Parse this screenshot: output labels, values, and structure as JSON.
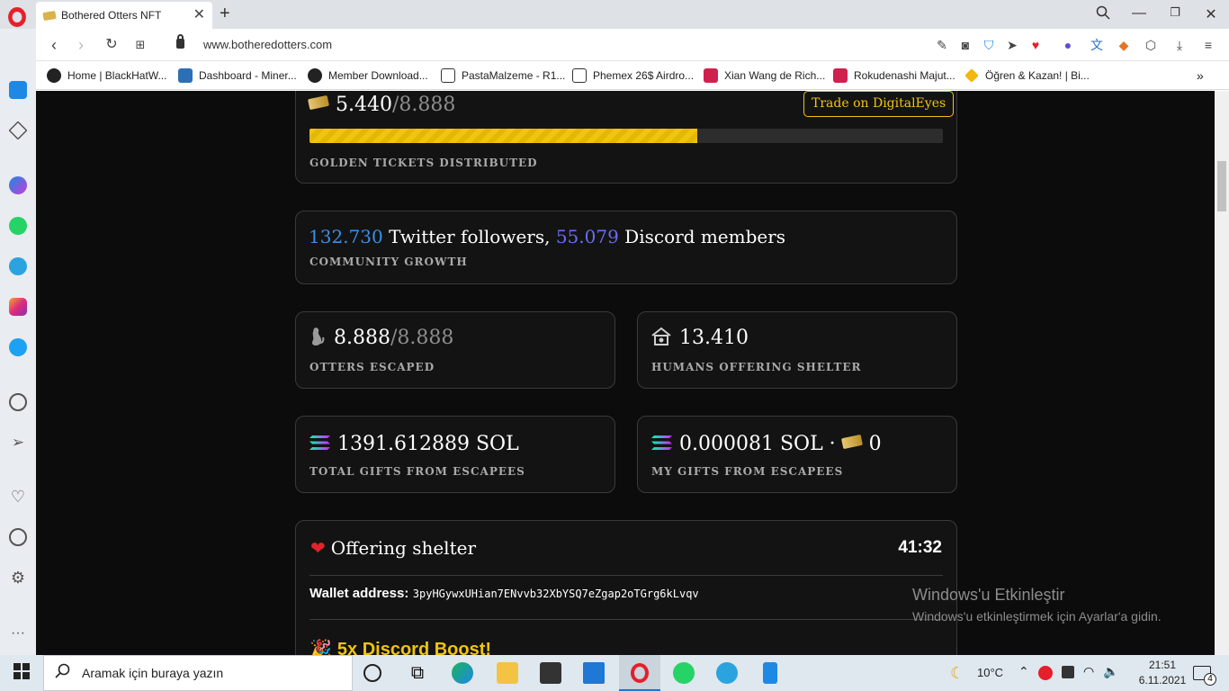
{
  "browser": {
    "tab_title": "Bothered Otters NFT",
    "url": "www.botheredotters.com",
    "bookmarks": [
      "Home | BlackHatW...",
      "Dashboard - Miner...",
      "Member Download...",
      "PastaMalzeme - R1...",
      "Phemex 26$ Airdro...",
      "Xian Wang de Rich...",
      "Rokudenashi Majut...",
      "Öğren & Kazan! | Bi..."
    ],
    "bookmarks_more": "»"
  },
  "tickets": {
    "current": "5.440",
    "total": "/8.888",
    "progress": 0.612,
    "label": "GOLDEN TICKETS DISTRIBUTED",
    "trade_button": "Trade on DigitalEyes"
  },
  "community": {
    "twitter_count": "132.730",
    "twitter_text": " Twitter followers, ",
    "discord_count": "55.079",
    "discord_text": " Discord members",
    "label": "COMMUNITY GROWTH"
  },
  "otters": {
    "current": "8.888",
    "total": "/8.888",
    "label": "OTTERS ESCAPED"
  },
  "humans": {
    "value": "13.410",
    "label": "HUMANS OFFERING SHELTER"
  },
  "total_gifts": {
    "value": "1391.612889 SOL",
    "label": "TOTAL GIFTS FROM ESCAPEES"
  },
  "my_gifts": {
    "value": "0.000081 SOL · ",
    "tickets": "0",
    "label": "MY GIFTS FROM ESCAPEES"
  },
  "shelter": {
    "title": "Offering shelter",
    "timer": "41:32",
    "wallet_label": "Wallet address:",
    "wallet_value": "3pyHGywxUHian7ENvvb32XbYSQ7eZgap2oTGrg6kLvqv",
    "boost": "5x Discord Boost!"
  },
  "watermark": {
    "title": "Windows'u Etkinleştir",
    "subtitle": "Windows'u etkinleştirmek için Ayarlar'a gidin."
  },
  "taskbar": {
    "search_placeholder": "Aramak için buraya yazın",
    "weather": "10°C",
    "time": "21:51",
    "date": "6.11.2021",
    "notifications": "4"
  },
  "colors": {
    "accent_yellow": "#f1c40f",
    "twitter_blue": "#3a8fe8",
    "discord_purple": "#6b6bf0",
    "page_bg": "#0c0c0c"
  }
}
